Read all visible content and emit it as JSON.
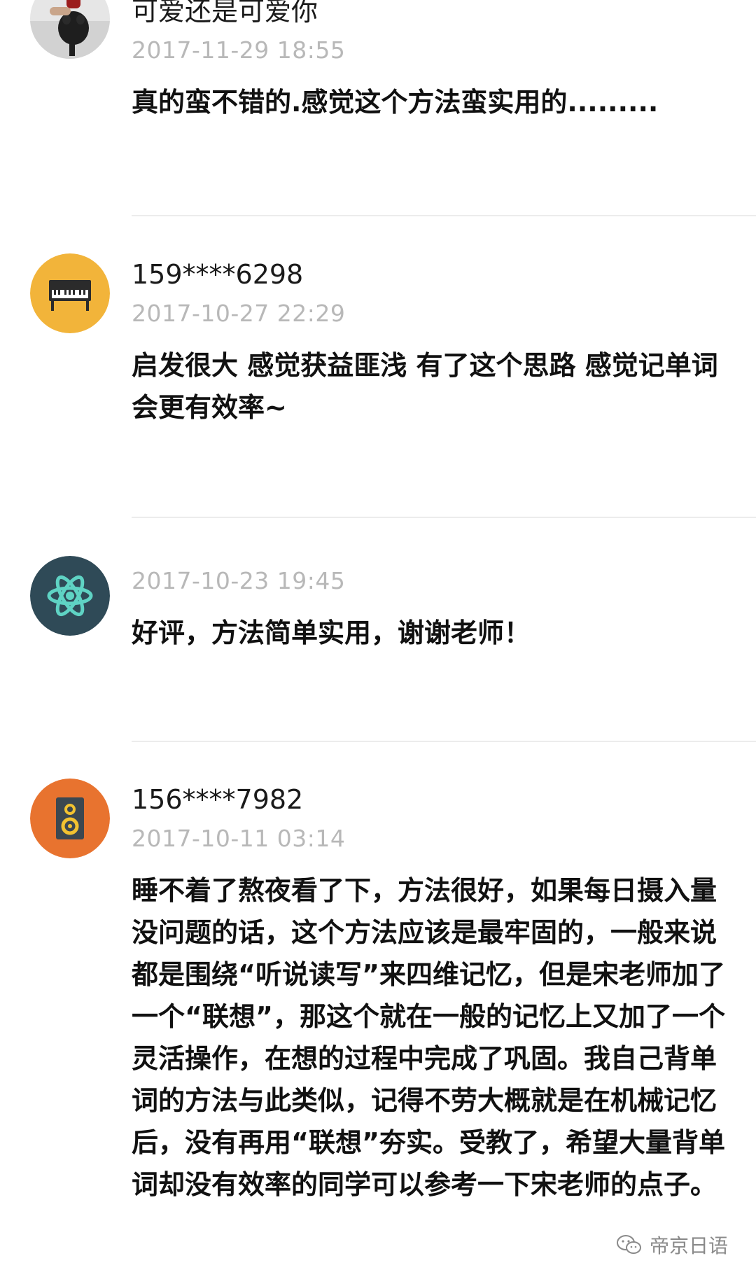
{
  "comments": [
    {
      "username": "可爱还是可爱你",
      "timestamp": "2017-11-29 18:55",
      "content": "真的蛮不错的.感觉这个方法蛮实用的.........",
      "avatar_icon": "photo-avatar",
      "avatar_color": "#dcdcdc"
    },
    {
      "username": "159****6298",
      "timestamp": "2017-10-27 22:29",
      "content": "启发很大 感觉获益匪浅 有了这个思路 感觉记单词会更有效率~",
      "avatar_icon": "piano-icon",
      "avatar_color": "#f2b43a"
    },
    {
      "username": "",
      "timestamp": "2017-10-23 19:45",
      "content": "好评，方法简单实用，谢谢老师！",
      "avatar_icon": "atom-icon",
      "avatar_color": "#2f4a57"
    },
    {
      "username": "156****7982",
      "timestamp": "2017-10-11 03:14",
      "content": "睡不着了熬夜看了下，方法很好，如果每日摄入量没问题的话，这个方法应该是最牢固的，一般来说都是围绕“听说读写”来四维记忆，但是宋老师加了一个“联想”，那这个就在一般的记忆上又加了一个灵活操作，在想的过程中完成了巩固。我自己背单词的方法与此类似，记得不劳大概就是在机械记忆后，没有再用“联想”夯实。受教了，希望大量背单词却没有效率的同学可以参考一下宋老师的点子。",
      "avatar_icon": "speaker-icon",
      "avatar_color": "#e8732f"
    }
  ],
  "watermark": {
    "text": "帝京日语",
    "icon": "wechat-icon"
  }
}
